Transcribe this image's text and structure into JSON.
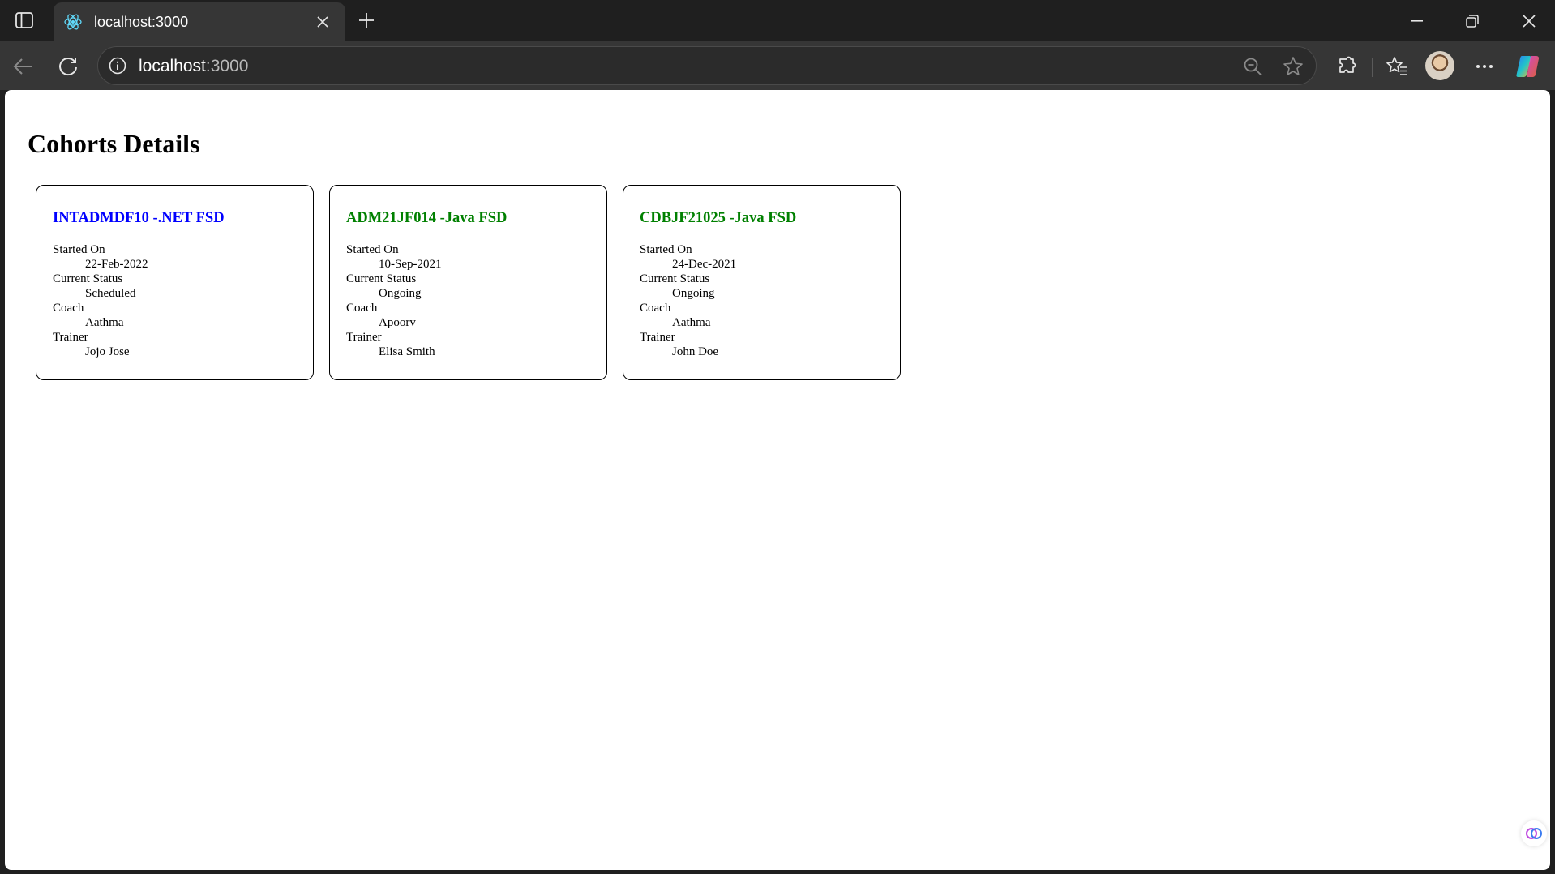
{
  "browser": {
    "tab": {
      "title": "localhost:3000",
      "favicon": "react-icon"
    },
    "address": {
      "host": "localhost",
      "port": ":3000"
    },
    "colors": {
      "frame": "#1f1f1f",
      "toolbar": "#363636",
      "active_tab": "#363636"
    }
  },
  "page": {
    "title": "Cohorts Details",
    "field_labels": {
      "started_on": "Started On",
      "current_status": "Current Status",
      "coach": "Coach",
      "trainer": "Trainer"
    },
    "status_colors": {
      "scheduled": "#0000ff",
      "ongoing": "#008000"
    },
    "cohorts": [
      {
        "name": "INTADMDF10 -.NET FSD",
        "started_on": "22-Feb-2022",
        "current_status": "Scheduled",
        "coach": "Aathma",
        "trainer": "Jojo Jose",
        "name_color": "#0000ff"
      },
      {
        "name": "ADM21JF014 -Java FSD",
        "started_on": "10-Sep-2021",
        "current_status": "Ongoing",
        "coach": "Apoorv",
        "trainer": "Elisa Smith",
        "name_color": "#008000"
      },
      {
        "name": "CDBJF21025 -Java FSD",
        "started_on": "24-Dec-2021",
        "current_status": "Ongoing",
        "coach": "Aathma",
        "trainer": "John Doe",
        "name_color": "#008000"
      }
    ]
  }
}
